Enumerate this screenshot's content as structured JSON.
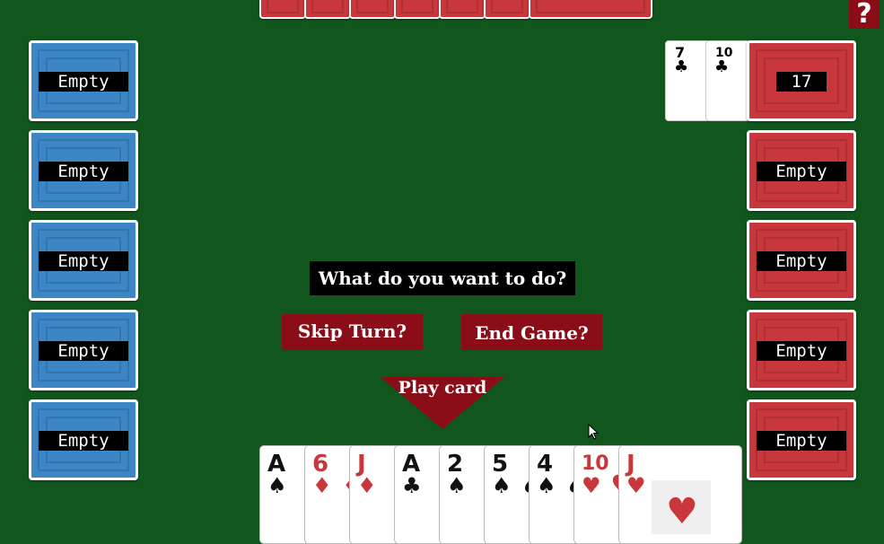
{
  "help_label": "?",
  "question": "What do you want to do?",
  "buttons": {
    "skip": "Skip Turn?",
    "end": "End Game?",
    "play": "Play card"
  },
  "left_piles": [
    "Empty",
    "Empty",
    "Empty",
    "Empty",
    "Empty"
  ],
  "right_piles": [
    "17",
    "Empty",
    "Empty",
    "Empty",
    "Empty"
  ],
  "draw_cards": [
    {
      "rank": "7",
      "suit": "♣"
    },
    {
      "rank": "10",
      "suit": "♣"
    }
  ],
  "hand": [
    {
      "rank": "A",
      "suit": "♠",
      "color": "black"
    },
    {
      "rank": "6",
      "suit": "♦",
      "color": "red"
    },
    {
      "rank": "J",
      "suit": "♦",
      "color": "red"
    },
    {
      "rank": "A",
      "suit": "♣",
      "color": "black"
    },
    {
      "rank": "2",
      "suit": "♠",
      "color": "black"
    },
    {
      "rank": "5",
      "suit": "♠",
      "color": "black"
    },
    {
      "rank": "4",
      "suit": "♠",
      "color": "black"
    },
    {
      "rank": "10",
      "suit": "♥",
      "color": "red"
    },
    {
      "rank": "J",
      "suit": "♥",
      "color": "red"
    }
  ],
  "colors": {
    "table": "#11561d",
    "button": "#8a0d18",
    "pile_blue": "#3d86c6",
    "pile_red": "#c8373b"
  }
}
